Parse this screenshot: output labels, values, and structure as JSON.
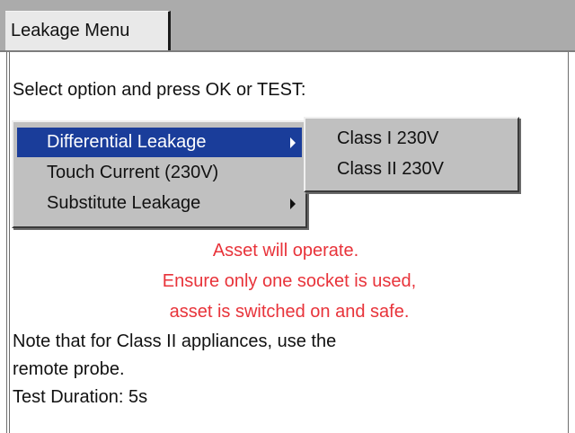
{
  "tab": {
    "label": "Leakage Menu"
  },
  "content": {
    "prompt": "Select option and press OK or TEST:",
    "warning_lines": [
      "Asset will operate.",
      "Ensure only one socket is used,",
      "asset is switched on and safe."
    ],
    "note_lines": [
      "Note that for Class II appliances, use the",
      "remote probe."
    ],
    "duration": "Test Duration: 5s"
  },
  "menu": {
    "items": [
      {
        "label": "Differential Leakage",
        "has_submenu": true,
        "selected": true
      },
      {
        "label": "Touch Current (230V)",
        "has_submenu": false,
        "selected": false
      },
      {
        "label": "Substitute Leakage",
        "has_submenu": true,
        "selected": false
      }
    ]
  },
  "submenu": {
    "items": [
      {
        "label": "Class I 230V"
      },
      {
        "label": "Class II 230V"
      }
    ]
  },
  "colors": {
    "tabbar": "#ababab",
    "menu_background": "#c0c0c0",
    "selection": "#1a3d9a",
    "warning_text": "#e8333a"
  },
  "icons": {
    "submenu_arrow": "triangle-right-icon"
  }
}
